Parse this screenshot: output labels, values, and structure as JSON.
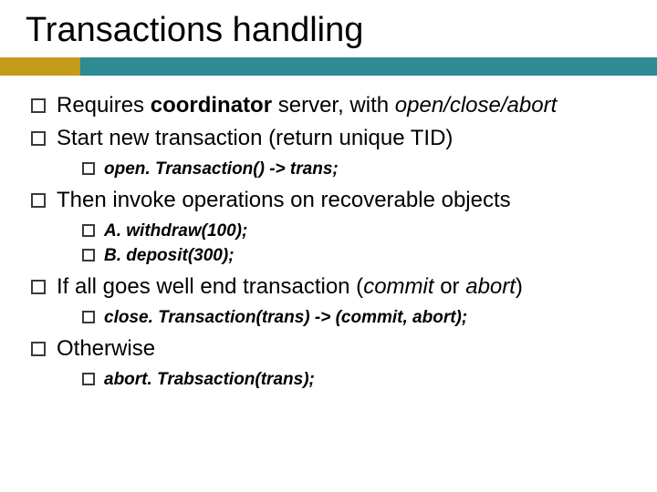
{
  "title": "Transactions handling",
  "bullets": {
    "b0": {
      "pre": "Requires ",
      "bold": "coordinator",
      "post": " server, with ",
      "italic": "open/close/abort"
    },
    "b1": {
      "text": "Start new transaction (return unique TID)",
      "sub0": {
        "bi": "open. Transaction()",
        "rest": " -> trans;"
      }
    },
    "b2": {
      "text": "Then invoke operations on recoverable objects",
      "sub0": {
        "bi": "A. withdraw(100);"
      },
      "sub1": {
        "bi": "B. deposit(300);"
      }
    },
    "b3": {
      "pre": "If all goes well end transaction (",
      "i1": "commit",
      "mid": " or ",
      "i2": "abort",
      "post": ")",
      "sub0": {
        "bi": "close. Transaction(trans)",
        "rest": " -> (commit, abort);"
      }
    },
    "b4": {
      "text": "Otherwise",
      "sub0": {
        "bi": "abort. Trabsaction(trans);"
      }
    }
  }
}
